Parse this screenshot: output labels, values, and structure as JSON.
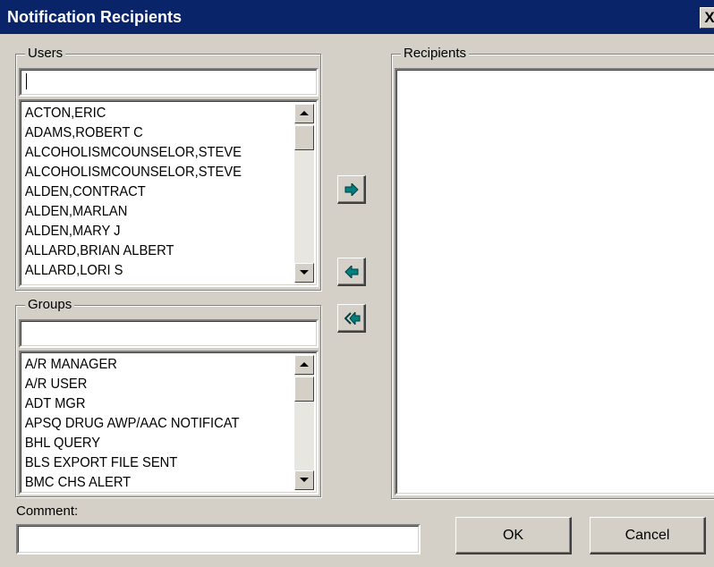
{
  "window": {
    "title": "Notification Recipients",
    "close_label": "X"
  },
  "users": {
    "label": "Users",
    "search_value": "",
    "items": [
      "ACTON,ERIC",
      "ADAMS,ROBERT C",
      "ALCOHOLISMCOUNSELOR,STEVE",
      "ALCOHOLISMCOUNSELOR,STEVE",
      "ALDEN,CONTRACT",
      "ALDEN,MARLAN",
      "ALDEN,MARY J",
      "ALLARD,BRIAN ALBERT",
      "ALLARD,LORI S"
    ]
  },
  "groups": {
    "label": "Groups",
    "search_value": "",
    "items": [
      "A/R MANAGER",
      "A/R USER",
      "ADT MGR",
      "APSQ DRUG AWP/AAC NOTIFICAT",
      "BHL QUERY",
      "BLS EXPORT FILE SENT",
      "BMC CHS ALERT"
    ]
  },
  "recipients": {
    "label": "Recipients",
    "items": []
  },
  "comment": {
    "label": "Comment:",
    "value": ""
  },
  "buttons": {
    "ok": "OK",
    "cancel": "Cancel"
  },
  "icons": {
    "add": "arrow-right-icon",
    "remove": "arrow-left-icon",
    "remove_all": "double-arrow-left-icon",
    "arrow_color": "#008080"
  }
}
